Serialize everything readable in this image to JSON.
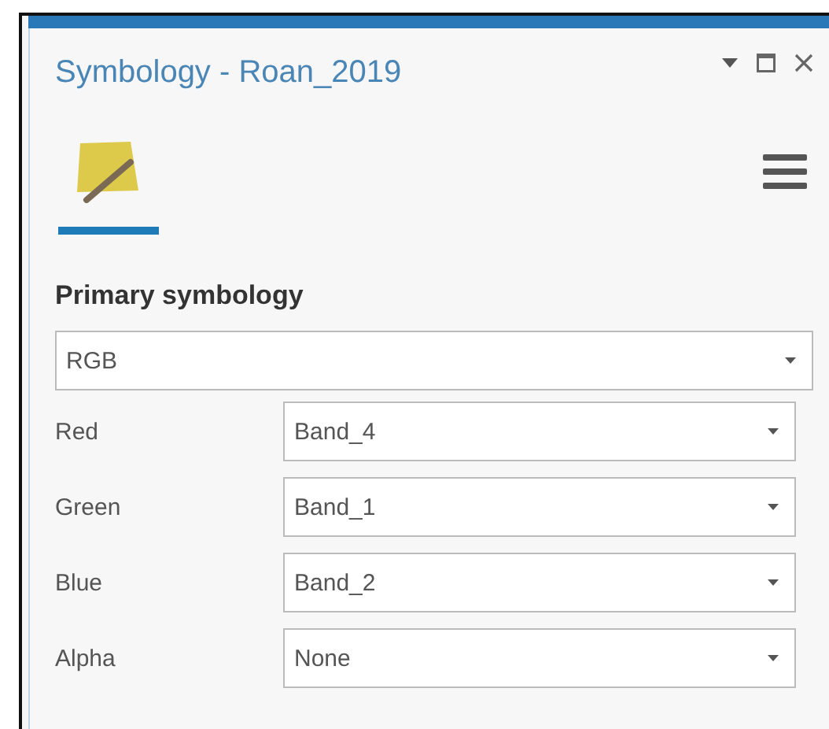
{
  "window": {
    "title": "Symbology - Roan_2019"
  },
  "tabs": [
    {
      "kind": "symbology",
      "selected": true
    }
  ],
  "section": {
    "title": "Primary symbology"
  },
  "renderer": {
    "value": "RGB"
  },
  "bands": [
    {
      "label": "Red",
      "value": "Band_4"
    },
    {
      "label": "Green",
      "value": "Band_1"
    },
    {
      "label": "Blue",
      "value": "Band_2"
    },
    {
      "label": "Alpha",
      "value": "None"
    }
  ]
}
